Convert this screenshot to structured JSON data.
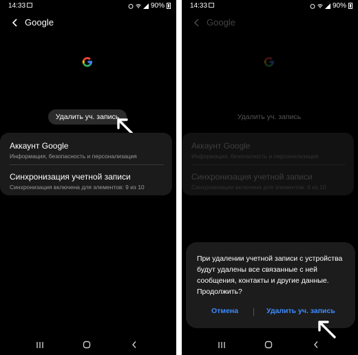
{
  "statusbar": {
    "time": "14:33",
    "battery": "90%"
  },
  "header": {
    "title": "Google"
  },
  "remove_account_label": "Удалить уч. запись",
  "settings": [
    {
      "title": "Аккаунт Google",
      "subtitle": "Информация, безопасность и персонализация"
    },
    {
      "title": "Синхронизация учетной записи",
      "subtitle": "Синхронизация включена для элементов: 9 из 10"
    }
  ],
  "dialog": {
    "message": "При удалении учетной записи с устройства будут удалены все связанные с ней сообщения, контакты и другие данные. Продолжить?",
    "cancel_label": "Отмена",
    "confirm_label": "Удалить уч. запись"
  },
  "colors": {
    "accent": "#3d8bff",
    "background": "#000000",
    "card": "#1b1b1b"
  },
  "icons": [
    "back-arrow-icon",
    "google-logo",
    "recent-apps-icon",
    "home-icon",
    "nav-back-icon",
    "wifi-icon",
    "signal-icon",
    "battery-icon"
  ]
}
